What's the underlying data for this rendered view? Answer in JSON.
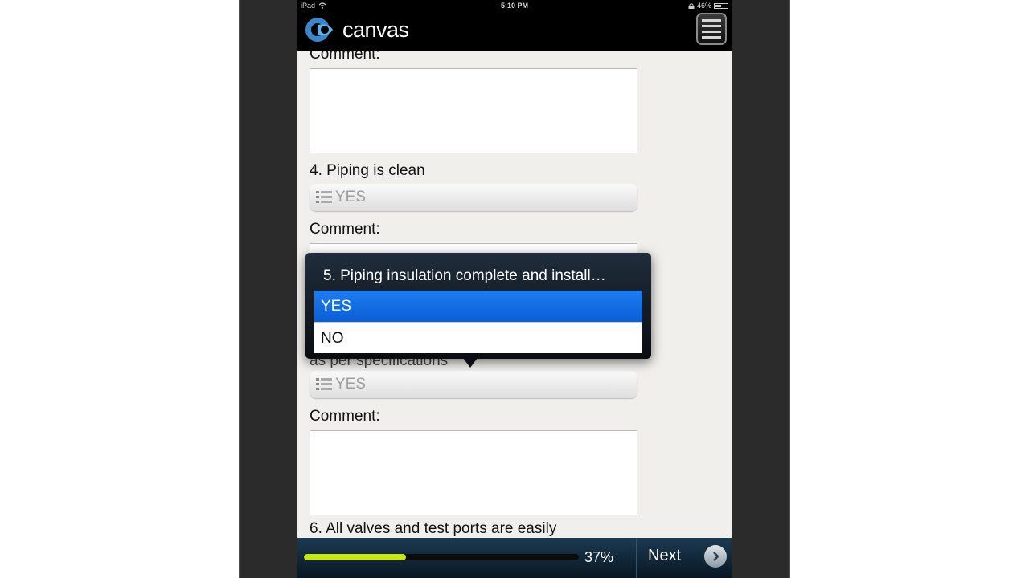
{
  "status_bar": {
    "device": "iPad",
    "time": "5:10 PM",
    "battery": "46%",
    "icons": [
      "wifi-icon",
      "lock-icon",
      "battery-icon"
    ]
  },
  "header": {
    "app_name": "canvas",
    "logo_color": "#3a86c8",
    "menu_icon": "hamburger-menu-icon"
  },
  "form": {
    "top_comment_label": "Comment:",
    "q4": {
      "label": "4. Piping is clean",
      "value": "YES",
      "comment_label": "Comment:"
    },
    "q5": {
      "visible_fragment": "as per specifications",
      "value": "YES",
      "comment_label": "Comment:"
    },
    "q6": {
      "label": "6. All valves and test ports are easily"
    }
  },
  "popover": {
    "title": "5. Piping insulation complete and install…",
    "options": [
      {
        "label": "YES",
        "selected": true
      },
      {
        "label": "NO",
        "selected": false
      }
    ],
    "selected_color": "#1a73e8"
  },
  "footer": {
    "progress_fraction": 0.37,
    "progress_text": "37%",
    "progress_color": "#c6e61c",
    "next_label": "Next",
    "next_icon": "chevron-right-icon"
  }
}
